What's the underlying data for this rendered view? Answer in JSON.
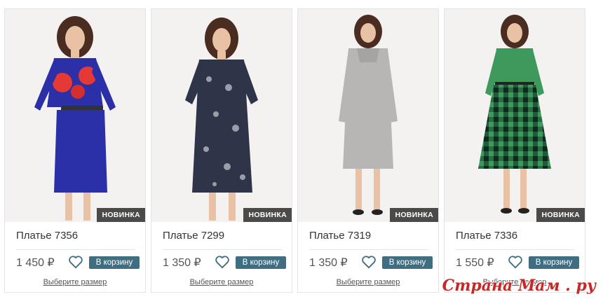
{
  "products": [
    {
      "name": "Платье 7356",
      "price": "1 450 ₽",
      "badge": "НОВИНКА",
      "cart_label": "В корзину",
      "size_link": "Выберите размер",
      "dress_color": "#2b2fa8",
      "accent_color": "#e53935"
    },
    {
      "name": "Платье 7299",
      "price": "1 350 ₽",
      "badge": "НОВИНКА",
      "cart_label": "В корзину",
      "size_link": "Выберите размер",
      "dress_color": "#2e3548",
      "accent_color": "#c9cbd3"
    },
    {
      "name": "Платье 7319",
      "price": "1 350 ₽",
      "badge": "НОВИНКА",
      "cart_label": "В корзину",
      "size_link": "Выберите размер",
      "dress_color": "#b8b6b4",
      "accent_color": "#9e9c9a"
    },
    {
      "name": "Платье 7336",
      "price": "1 550 ₽",
      "badge": "НОВИНКА",
      "cart_label": "В корзину",
      "size_link": "Выберите размер",
      "dress_color": "#3e9a5c",
      "accent_color": "#1f5c38"
    }
  ],
  "watermark": "Страна Мам . ру",
  "colors": {
    "button": "#3f6e82",
    "badge": "#4a4a4a",
    "heart": "#3f6e82"
  },
  "icons": {
    "favorite": "heart-outline-icon"
  }
}
